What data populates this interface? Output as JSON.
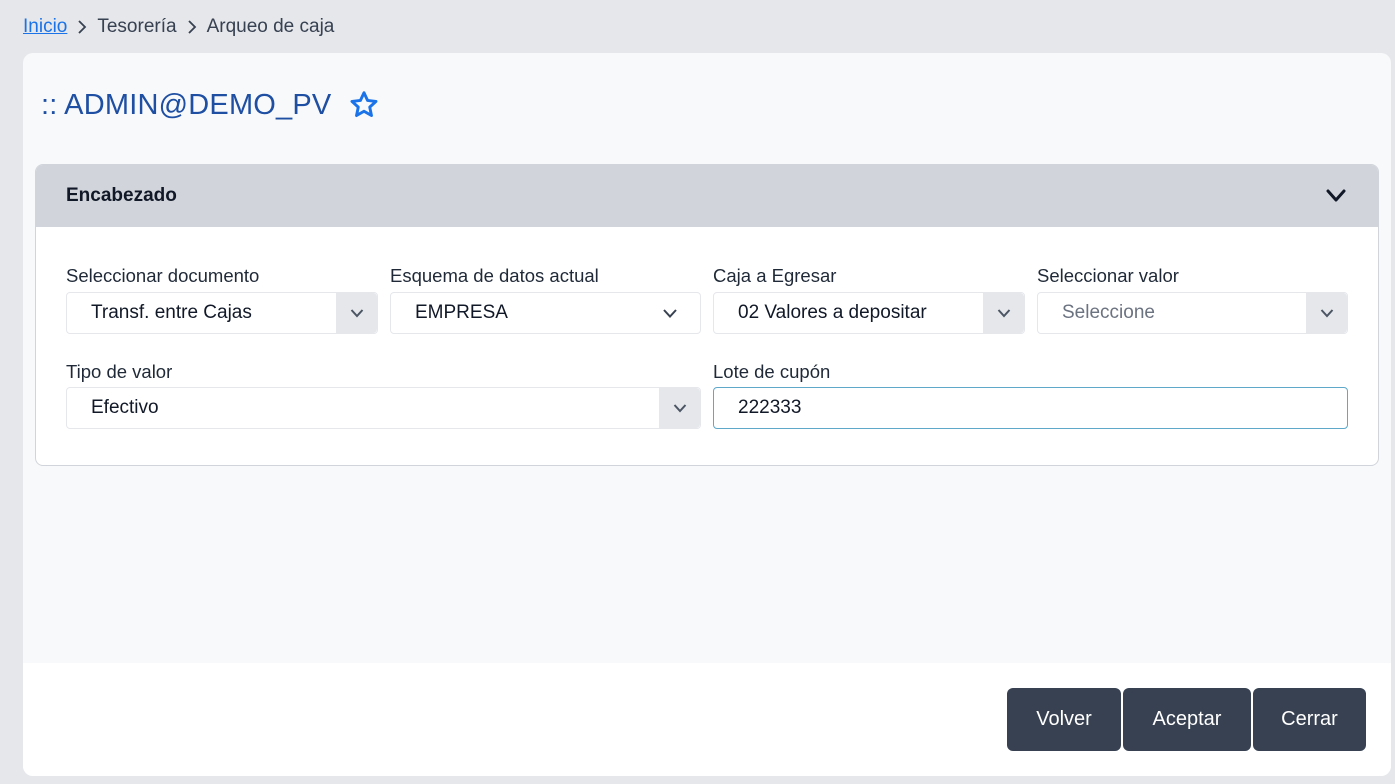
{
  "breadcrumb": {
    "home": "Inicio",
    "section": "Tesorería",
    "current": "Arqueo de caja"
  },
  "header": {
    "title": ":: ADMIN@DEMO_PV"
  },
  "panel": {
    "title": "Encabezado"
  },
  "fields": {
    "documento": {
      "label": "Seleccionar documento",
      "value": "Transf. entre Cajas"
    },
    "esquema": {
      "label": "Esquema de datos actual",
      "value": "EMPRESA"
    },
    "caja": {
      "label": "Caja a Egresar",
      "value": "02 Valores a depositar"
    },
    "valor": {
      "label": "Seleccionar valor",
      "placeholder": "Seleccione"
    },
    "tipo": {
      "label": "Tipo de valor",
      "value": "Efectivo"
    },
    "lote": {
      "label": "Lote de cupón",
      "value": "222333"
    }
  },
  "buttons": {
    "volver": "Volver",
    "aceptar": "Aceptar",
    "cerrar": "Cerrar"
  },
  "colors": {
    "accent": "#1a73e8",
    "title": "#1e4fa3",
    "button_bg": "#374151"
  }
}
